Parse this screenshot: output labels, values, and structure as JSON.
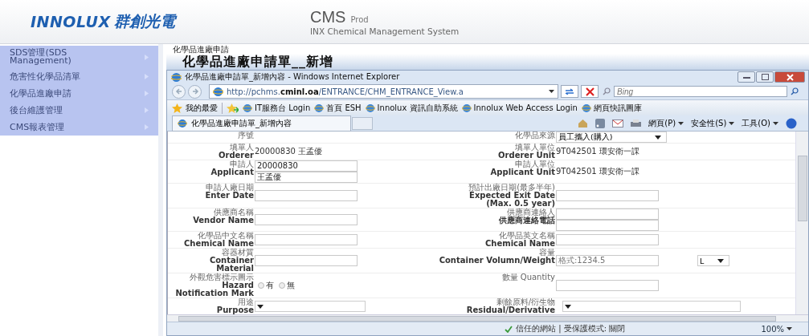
{
  "header": {
    "brand": "INNOLUX",
    "brand_cjk": "群創光電",
    "app_name": "CMS",
    "env": "Prod",
    "app_subtitle": "INX Chemical Management System"
  },
  "sidebar": {
    "items": [
      {
        "label": "SDS管理(SDS Management)"
      },
      {
        "label": "危害性化學品清單"
      },
      {
        "label": "化學品進廠申請"
      },
      {
        "label": "後台維護管理"
      },
      {
        "label": "CMS報表管理"
      }
    ]
  },
  "page": {
    "breadcrumb": "化學品進廠申請",
    "title": "化學品進廠申請單__新增"
  },
  "browser": {
    "title": "化學品進廠申請單_新增內容 - Windows Internet Explorer",
    "url_prefix": "http://pchms.",
    "url_domain": "cminl.oa",
    "url_path": "/ENTRANCE/CHM_ENTRANCE_View.a",
    "search_placeholder": "Bing",
    "favorites_label": "我的最愛",
    "favorites": [
      "IT服務台 Login",
      "首頁 ESH",
      "Innolux 資訊自助系統",
      "Innolux Web Access Login",
      "網頁快訊圖庫"
    ],
    "tab_title": "化學品進廠申請單_新增內容",
    "menus": [
      "網頁(P)",
      "安全性(S)",
      "工具(O)"
    ],
    "status_zone": "信任的網站 | 受保護模式: 關閉",
    "zoom": "100%"
  },
  "form": {
    "rows": [
      {
        "cells": [
          {
            "label": [
              "序號"
            ],
            "kind": "none"
          },
          {
            "label": [
              "化學品來源"
            ],
            "kind": "select",
            "value": "員工攜入(購入)"
          }
        ]
      },
      {
        "cells": [
          {
            "label": [
              "填單人",
              "Orderer"
            ],
            "kind": "text",
            "value": "20000830 王孟優"
          },
          {
            "label": [
              "填單人單位",
              "Orderer Unit"
            ],
            "kind": "text",
            "value": "9T042501 環安衛一課"
          }
        ]
      },
      {
        "cells": [
          {
            "label": [
              "申請人",
              "Applicant"
            ],
            "kind": "inputs",
            "values": [
              "20000830",
              "王孟優"
            ]
          },
          {
            "label": [
              "申請人單位",
              "Applicant Unit"
            ],
            "kind": "text",
            "value": "9T042501 環安衛一課"
          }
        ]
      },
      {
        "cells": [
          {
            "label": [
              "申請人廠日期",
              "Enter Date"
            ],
            "kind": "input"
          },
          {
            "label": [
              "預計出廠日期(最多半年)",
              "Expected Exit Date",
              "(Max. 0.5 year)"
            ],
            "kind": "input"
          }
        ]
      },
      {
        "cells": [
          {
            "label": [
              "供應商名稱",
              "Vendor Name"
            ],
            "kind": "input"
          },
          {
            "label": [
              "供應商連絡人",
              "供應商連絡電話"
            ],
            "kind": "labeled_inputs"
          }
        ]
      },
      {
        "cells": [
          {
            "label": [
              "化學品中文名稱",
              "Chemical Name"
            ],
            "kind": "input"
          },
          {
            "label": [
              "化學品英文名稱",
              "Chemical Name"
            ],
            "kind": "input"
          }
        ]
      },
      {
        "cells": [
          {
            "label": [
              "容器材質",
              "Container",
              "Material"
            ],
            "kind": "input"
          },
          {
            "label": [
              "容量",
              "Container Volumn/Weight"
            ],
            "kind": "input_unit",
            "placeholder": "格式:1234.5",
            "unit": "L"
          }
        ]
      },
      {
        "cells": [
          {
            "label": [
              "外觀危害標示圖示",
              "Hazard",
              "Notification Mark"
            ],
            "kind": "radio",
            "options": [
              {
                "label": "有",
                "selected": false
              },
              {
                "label": "無",
                "selected": false
              }
            ]
          },
          {
            "label": [
              "數量 Quantity"
            ],
            "kind": "input"
          }
        ]
      },
      {
        "cells": [
          {
            "label": [
              "用途",
              "Purpose"
            ],
            "kind": "select"
          },
          {
            "label": [
              "剩餘原料/衍生物",
              "Residual/Derivative"
            ],
            "kind": "select_wide"
          }
        ]
      }
    ]
  }
}
